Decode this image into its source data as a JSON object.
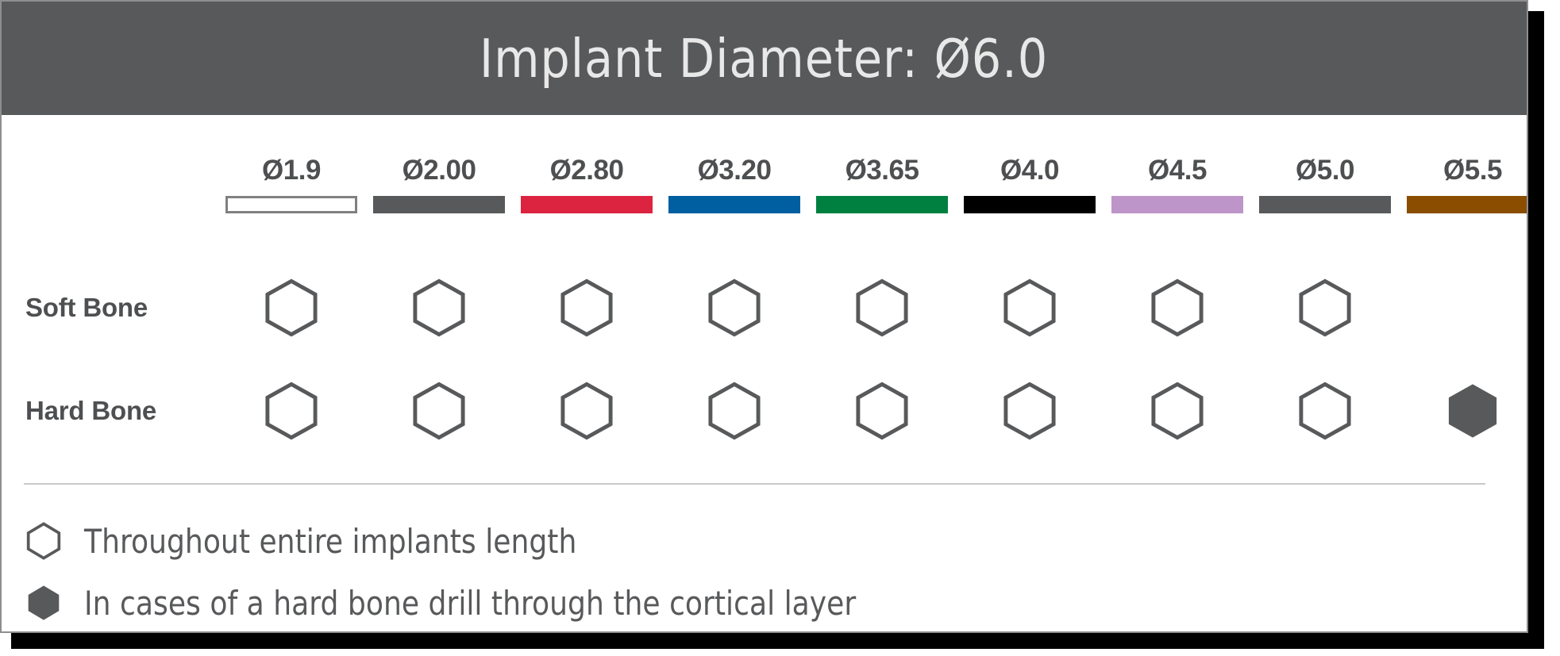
{
  "header": {
    "title": "Implant Diameter: Ø6.0"
  },
  "colors": {
    "header_bg": "#58595B",
    "header_text": "#E8E8E8",
    "text": "#4D4F51",
    "card_border": "#8E8E8E",
    "divider": "#C9C9C9",
    "hex_outline": "#58595B",
    "hex_fill": "#58595B"
  },
  "drills": [
    {
      "label": "Ø1.9",
      "bar_color": "#FFFFFF",
      "bar_border": "#808080"
    },
    {
      "label": "Ø2.00",
      "bar_color": "#58595B",
      "bar_border": "#58595B"
    },
    {
      "label": "Ø2.80",
      "bar_color": "#DC2440",
      "bar_border": "#DC2440"
    },
    {
      "label": "Ø3.20",
      "bar_color": "#005FA0",
      "bar_border": "#005FA0"
    },
    {
      "label": "Ø3.65",
      "bar_color": "#008040",
      "bar_border": "#008040"
    },
    {
      "label": "Ø4.0",
      "bar_color": "#000000",
      "bar_border": "#000000"
    },
    {
      "label": "Ø4.5",
      "bar_color": "#BD95C8",
      "bar_border": "#BD95C8"
    },
    {
      "label": "Ø5.0",
      "bar_color": "#58595B",
      "bar_border": "#58595B"
    },
    {
      "label": "Ø5.5",
      "bar_color": "#8B4E00",
      "bar_border": "#8B4E00"
    }
  ],
  "rows": [
    {
      "label": "Soft Bone",
      "marks": [
        "outline",
        "outline",
        "outline",
        "outline",
        "outline",
        "outline",
        "outline",
        "outline",
        "none"
      ]
    },
    {
      "label": "Hard Bone",
      "marks": [
        "outline",
        "outline",
        "outline",
        "outline",
        "outline",
        "outline",
        "outline",
        "outline",
        "filled"
      ]
    }
  ],
  "legend": [
    {
      "mark": "outline",
      "text": "Throughout entire implants length"
    },
    {
      "mark": "filled",
      "text": "In cases of a hard bone drill through the cortical layer"
    }
  ]
}
